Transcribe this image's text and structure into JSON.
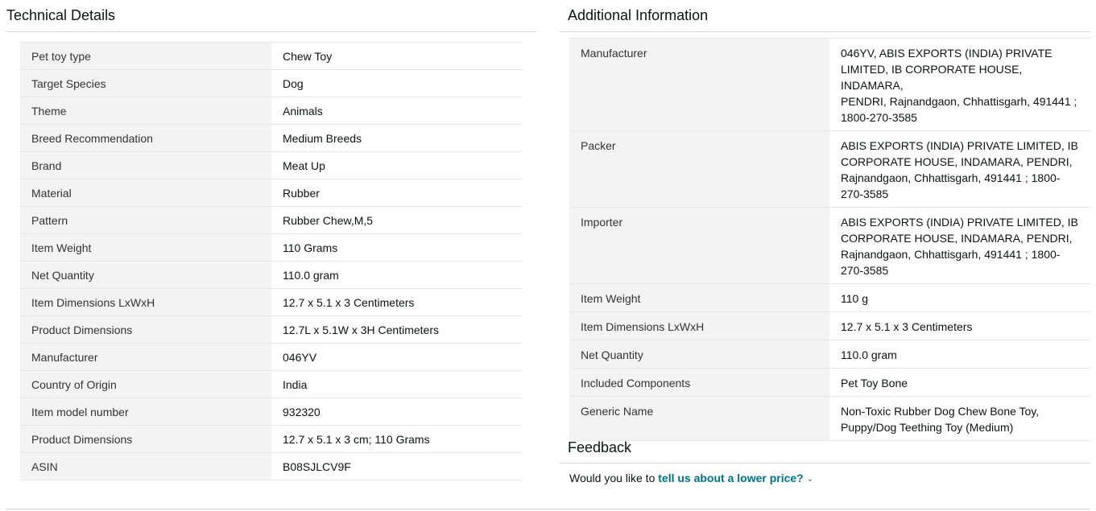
{
  "technical": {
    "title": "Technical Details",
    "rows": [
      {
        "k": "Pet toy type",
        "v": "Chew Toy"
      },
      {
        "k": "Target Species",
        "v": "Dog"
      },
      {
        "k": "Theme",
        "v": "Animals"
      },
      {
        "k": "Breed Recommendation",
        "v": "Medium Breeds"
      },
      {
        "k": "Brand",
        "v": "Meat Up"
      },
      {
        "k": "Material",
        "v": "Rubber"
      },
      {
        "k": "Pattern",
        "v": "Rubber Chew,M,5"
      },
      {
        "k": "Item Weight",
        "v": "110 Grams"
      },
      {
        "k": "Net Quantity",
        "v": "110.0 gram"
      },
      {
        "k": "Item Dimensions LxWxH",
        "v": "12.7 x 5.1 x 3 Centimeters"
      },
      {
        "k": "Product Dimensions",
        "v": "12.7L x 5.1W x 3H Centimeters"
      },
      {
        "k": "Manufacturer",
        "v": "046YV"
      },
      {
        "k": "Country of Origin",
        "v": "India"
      },
      {
        "k": "Item model number",
        "v": "932320"
      },
      {
        "k": "Product Dimensions",
        "v": "12.7 x 5.1 x 3 cm; 110 Grams"
      },
      {
        "k": "ASIN",
        "v": "B08SJLCV9F"
      }
    ]
  },
  "additional": {
    "title": "Additional Information",
    "rows": [
      {
        "k": "Manufacturer",
        "lines": [
          "046YV, ABIS EXPORTS (INDIA) PRIVATE",
          "LIMITED, IB CORPORATE HOUSE, INDAMARA,",
          "PENDRI, Rajnandgaon, Chhattisgarh, 491441 ;",
          "1800-270-3585"
        ]
      },
      {
        "k": "Packer",
        "lines": [
          "ABIS EXPORTS (INDIA) PRIVATE LIMITED, IB",
          "CORPORATE HOUSE, INDAMARA, PENDRI,",
          "Rajnandgaon, Chhattisgarh, 491441 ; 1800-",
          "270-3585"
        ]
      },
      {
        "k": "Importer",
        "lines": [
          "ABIS EXPORTS (INDIA) PRIVATE LIMITED, IB",
          "CORPORATE HOUSE, INDAMARA, PENDRI,",
          "Rajnandgaon, Chhattisgarh, 491441 ; 1800-",
          "270-3585"
        ]
      },
      {
        "k": "Item Weight",
        "lines": [
          "110 g"
        ]
      },
      {
        "k": "Item Dimensions LxWxH",
        "lines": [
          "12.7 x 5.1 x 3 Centimeters"
        ]
      },
      {
        "k": "Net Quantity",
        "lines": [
          "110.0 gram"
        ]
      },
      {
        "k": "Included Components",
        "lines": [
          "Pet Toy Bone"
        ]
      },
      {
        "k": "Generic Name",
        "lines": [
          "Non-Toxic Rubber Dog Chew Bone Toy,",
          "Puppy/Dog Teething Toy (Medium)"
        ]
      }
    ]
  },
  "feedback": {
    "title": "Feedback",
    "prompt": "Would you like to ",
    "link": "tell us about a lower price?",
    "chevron_icon": "chevron-down-icon"
  }
}
